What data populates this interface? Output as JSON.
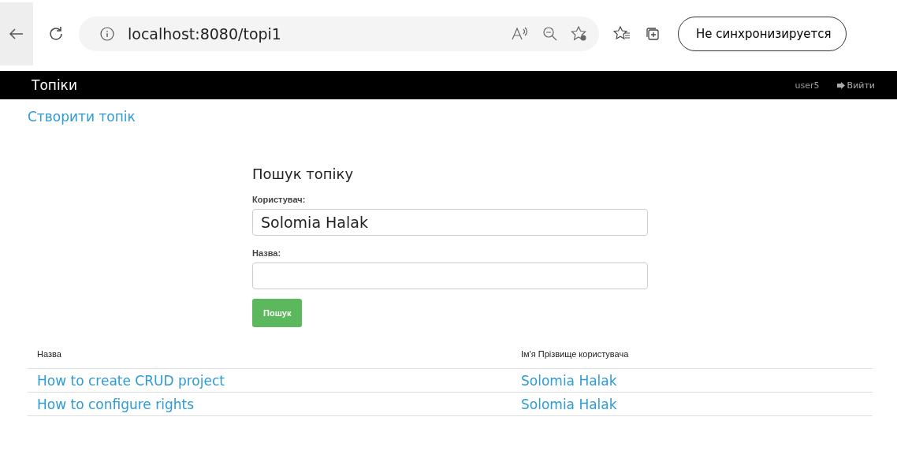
{
  "browser": {
    "url": "localhost:8080/topi1",
    "sync_button": "Не синхронизируется"
  },
  "navbar": {
    "brand": "Топіки",
    "user": "user5",
    "logout": "Вийти"
  },
  "create_link": "Створити топік",
  "search_form": {
    "title": "Пошук топіку",
    "fields": [
      {
        "label": "Користувач:",
        "value": "Solomia Halak"
      },
      {
        "label": "Назва:"
      }
    ],
    "button": "Пошук"
  },
  "table": {
    "columns": [
      "Назва",
      "Ім'я Прізвище користувача"
    ],
    "rows": [
      [
        "How to create CRUD project",
        "Solomia Halak"
      ],
      [
        "How to configure rights",
        "Solomia Halak"
      ]
    ]
  }
}
